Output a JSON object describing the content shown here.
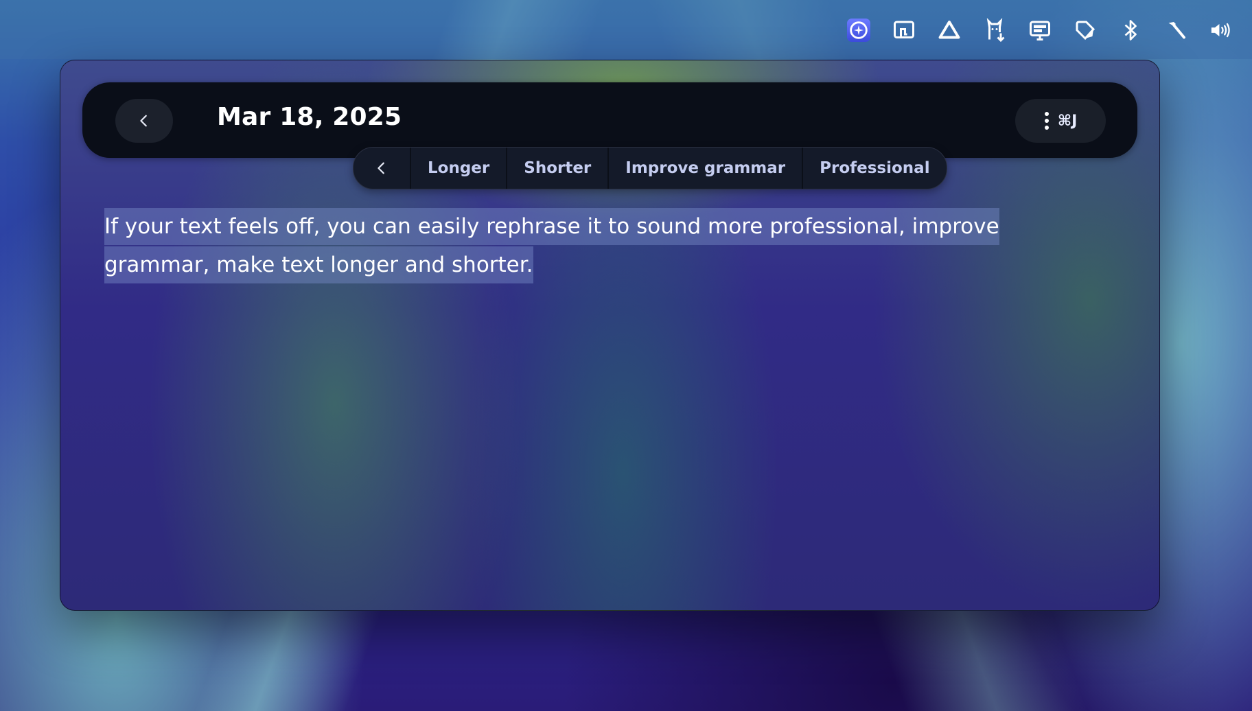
{
  "menubar": {
    "tray_icons": [
      {
        "name": "ai-assistant-icon",
        "active": true
      },
      {
        "name": "screen-share-icon"
      },
      {
        "name": "drive-icon"
      },
      {
        "name": "llama-download-icon"
      },
      {
        "name": "display-icon"
      },
      {
        "name": "tag-icon"
      },
      {
        "name": "bluetooth-icon"
      },
      {
        "name": "hammer-icon"
      },
      {
        "name": "volume-icon"
      }
    ]
  },
  "window": {
    "title": "Mar 18, 2025",
    "shortcut_label": "⌘J",
    "rephrase_toolbar": {
      "options": [
        "Longer",
        "Shorter",
        "Improve grammar",
        "Professional"
      ]
    },
    "editor_text": "If your text feels off, you can easily rephrase it to sound more professional, improve grammar, make text longer and shorter."
  },
  "colors": {
    "titlebar_bg": "#0a0e18",
    "selection": "#7a8cc8",
    "toolbar_text": "#c5cdf0"
  }
}
